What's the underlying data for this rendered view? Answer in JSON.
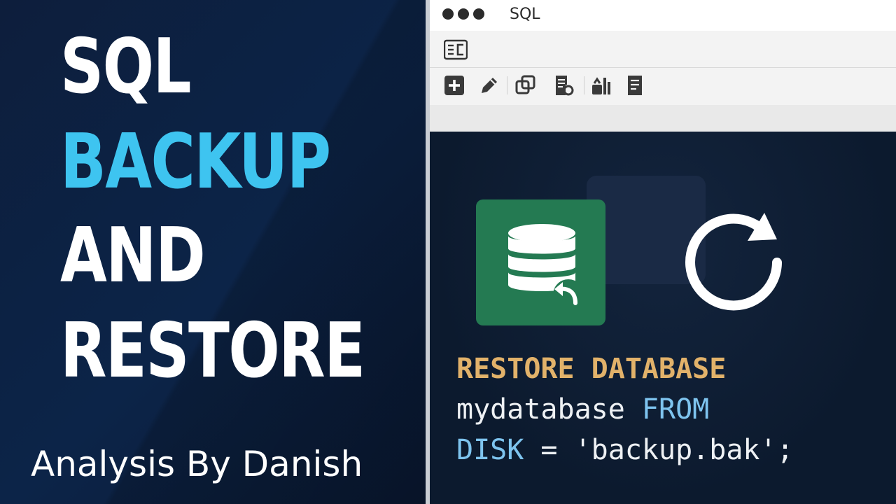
{
  "left_panel": {
    "title_lines": [
      "SQL",
      "BACKUP",
      "AND",
      "RESTORE"
    ],
    "credit": "Analysis By Danish",
    "colors": {
      "title": "#ffffff",
      "accent": "#3ec4f0"
    }
  },
  "window": {
    "title": "SQL",
    "menu_icon": "expand-collapse-icon",
    "toolbar_icons": [
      "add-icon",
      "edit-icon",
      "copy-icon",
      "document-settings-icon",
      "database-tools-icon",
      "script-icon"
    ]
  },
  "editor": {
    "icons": [
      "database-restore-icon",
      "refresh-icon"
    ],
    "code": {
      "line1": "RESTORE DATABASE",
      "line2_ident": "mydatabase",
      "line2_kw": "FROM",
      "line3_kw": "DISK",
      "line3_rest": " = 'backup.bak';"
    },
    "colors": {
      "keyword_bold": "#e2b26a",
      "keyword": "#7ec4ef",
      "text": "#eef1f4",
      "db_card": "#247a52"
    }
  }
}
